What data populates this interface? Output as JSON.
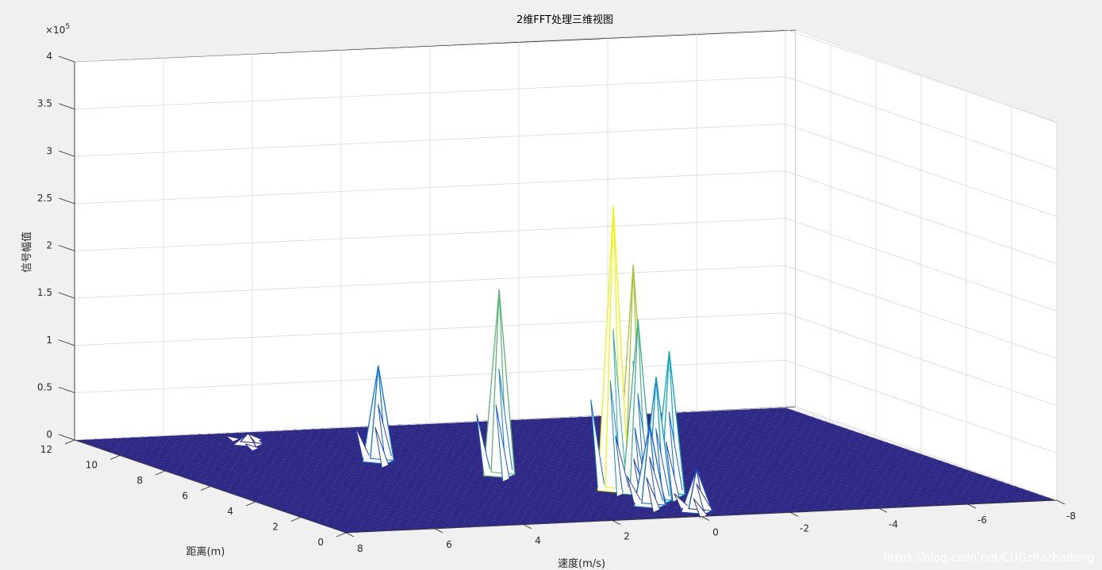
{
  "chart_data": {
    "type": "surface3d",
    "title": "2维FFT处理三维视图",
    "xlabel": "速度(m/s)",
    "ylabel": "距离(m)",
    "zlabel": "信号幅值",
    "z_exponent_label": "×10",
    "z_exponent": "5",
    "xlim": [
      -8,
      8
    ],
    "ylim": [
      0,
      12
    ],
    "zlim": [
      0,
      400000
    ],
    "x_direction": "reversed",
    "x_ticks": [
      "8",
      "6",
      "4",
      "2",
      "0",
      "-2",
      "-4",
      "-6",
      "-8"
    ],
    "y_ticks": [
      "0",
      "2",
      "4",
      "6",
      "8",
      "10",
      "12"
    ],
    "z_ticks": [
      "0",
      "0.5",
      "1",
      "1.5",
      "2",
      "2.5",
      "3",
      "3.5",
      "4"
    ],
    "grid": true,
    "colormap": "parula",
    "surface_color": "#2f2a86",
    "peaks": [
      {
        "velocity": 3.2,
        "range": 8.0,
        "amplitude": 101000
      },
      {
        "velocity": 1.6,
        "range": 5.8,
        "amplitude": 196000
      },
      {
        "velocity": 0.2,
        "range": 3.5,
        "amplitude": 300000
      },
      {
        "velocity": -0.3,
        "range": 3.6,
        "amplitude": 236000
      },
      {
        "velocity": -0.1,
        "range": 3.0,
        "amplitude": 184000
      },
      {
        "velocity": -0.6,
        "range": 2.6,
        "amplitude": 152000
      },
      {
        "velocity": 0.0,
        "range": 2.0,
        "amplitude": 131000
      },
      {
        "velocity": 0.4,
        "range": 1.5,
        "amplitude": 86000
      },
      {
        "velocity": 4.8,
        "range": 10.6,
        "amplitude": 12000
      },
      {
        "velocity": -0.2,
        "range": 0.6,
        "amplitude": 45000
      }
    ]
  },
  "watermark": "https://blog.csdn.net/CUGzhazhadong"
}
